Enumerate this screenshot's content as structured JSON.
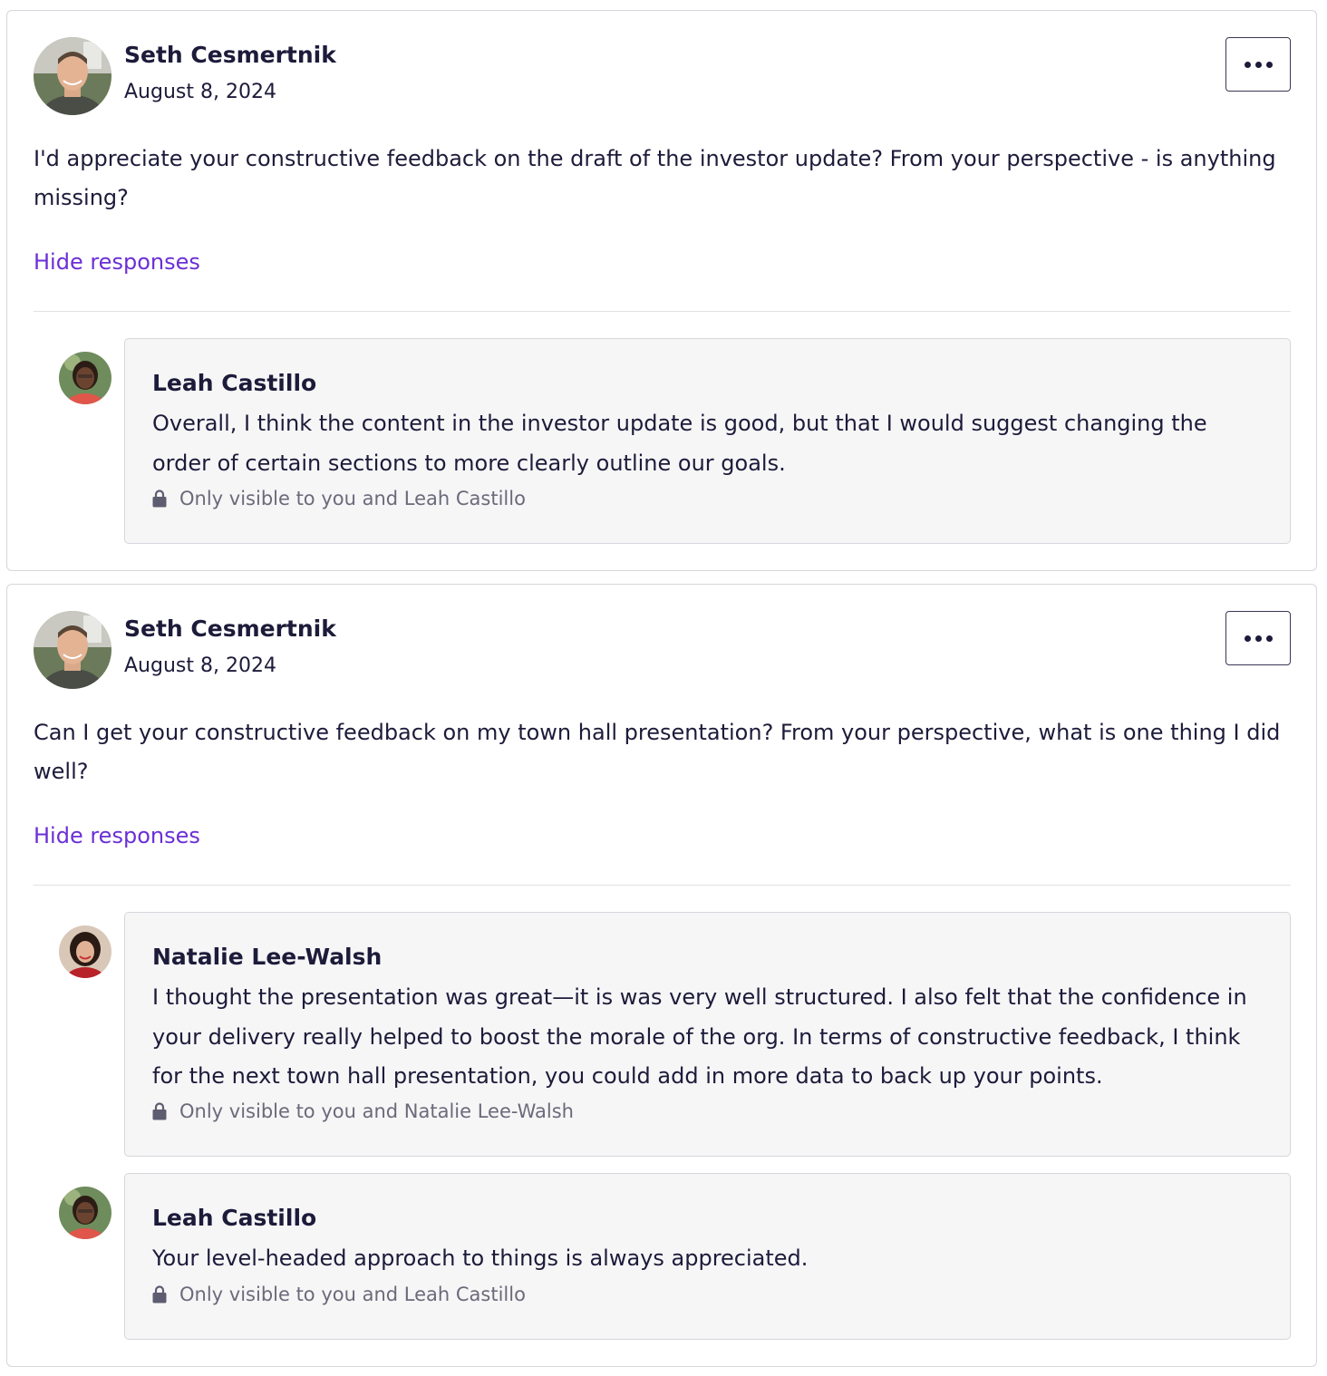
{
  "posts": [
    {
      "author": "Seth Cesmertnik",
      "date": "August 8, 2024",
      "body": "I'd appreciate your constructive feedback on the draft of the investor update? From your perspective - is anything missing?",
      "toggle_label": "Hide responses",
      "more_icon": "more-horizontal-icon",
      "responses": [
        {
          "author": "Leah Castillo",
          "text": "Overall, I think the content in the investor update is good, but that I would suggest changing the order of certain sections to more clearly outline our goals.",
          "privacy": "Only visible to you and Leah Castillo"
        }
      ]
    },
    {
      "author": "Seth Cesmertnik",
      "date": "August 8, 2024",
      "body": "Can I get your constructive feedback on my town hall presentation? From your perspective, what is one thing I did well?",
      "toggle_label": "Hide responses",
      "more_icon": "more-horizontal-icon",
      "responses": [
        {
          "author": "Natalie Lee-Walsh",
          "text": "I thought the presentation was great—it is was very well structured. I also felt that the confidence in your delivery really helped to boost the morale of the org. In terms of constructive feedback, I think for the next town hall presentation, you could add in more data to back up your points.",
          "privacy": "Only visible to you and Natalie Lee-Walsh"
        },
        {
          "author": "Leah Castillo",
          "text": "Your level-headed approach to things is always appreciated.",
          "privacy": "Only visible to you and Leah Castillo"
        }
      ]
    }
  ],
  "colors": {
    "text": "#1d1b3a",
    "link": "#6b2fd6",
    "muted": "#6b6a7a",
    "border": "#d6d6dc",
    "response_bg": "#f6f6f7"
  },
  "icons": {
    "lock": "lock-icon",
    "more": "more-horizontal-icon"
  }
}
